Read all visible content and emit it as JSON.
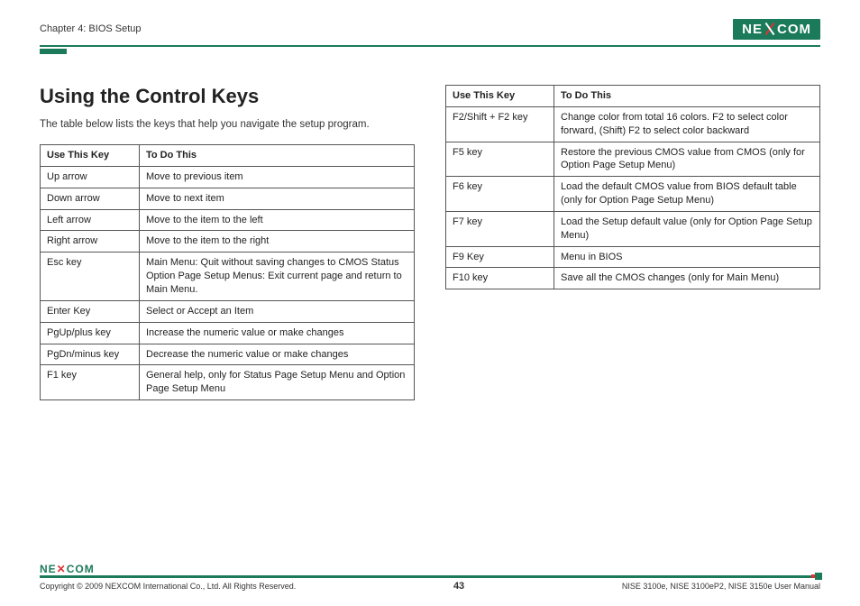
{
  "header": {
    "chapter": "Chapter 4: BIOS Setup",
    "logo_left": "NE",
    "logo_right": "COM"
  },
  "main": {
    "title": "Using the Control Keys",
    "intro": "The table below lists the keys that help you navigate the setup program.",
    "table1": {
      "head_key": "Use This Key",
      "head_do": "To Do This",
      "rows": [
        {
          "k": "Up arrow",
          "d": "Move to previous item"
        },
        {
          "k": "Down arrow",
          "d": "Move to next item"
        },
        {
          "k": "Left arrow",
          "d": "Move to the item to the left"
        },
        {
          "k": "Right arrow",
          "d": "Move to the item to the right"
        },
        {
          "k": "Esc key",
          "d": "Main Menu: Quit without saving changes to CMOS Status\nOption Page Setup Menus: Exit current page and return to Main Menu."
        },
        {
          "k": "Enter Key",
          "d": "Select or Accept an Item"
        },
        {
          "k": "PgUp/plus key",
          "d": "Increase the numeric value or make changes"
        },
        {
          "k": "PgDn/minus key",
          "d": "Decrease the numeric value or make changes"
        },
        {
          "k": "F1 key",
          "d": "General help, only for Status Page Setup Menu and Option Page Setup Menu"
        }
      ]
    },
    "table2": {
      "head_key": "Use This Key",
      "head_do": "To Do This",
      "rows": [
        {
          "k": "F2/Shift + F2 key",
          "d": "Change color from total 16 colors. F2 to select color forward, (Shift) F2 to select color backward"
        },
        {
          "k": "F5 key",
          "d": "Restore the previous CMOS value from CMOS (only for Option Page Setup Menu)"
        },
        {
          "k": "F6 key",
          "d": "Load the default CMOS value from BIOS default table (only for Option Page Setup Menu)"
        },
        {
          "k": "F7 key",
          "d": "Load the Setup default value (only for Option Page Setup Menu)"
        },
        {
          "k": "F9 Key",
          "d": "Menu in BIOS"
        },
        {
          "k": "F10 key",
          "d": "Save all the CMOS changes (only for Main Menu)"
        }
      ]
    }
  },
  "footer": {
    "logo_left": "NE",
    "logo_right": "COM",
    "copyright": "Copyright © 2009 NEXCOM International Co., Ltd. All Rights Reserved.",
    "page": "43",
    "manual": "NISE 3100e, NISE 3100eP2, NISE 3150e User Manual"
  }
}
